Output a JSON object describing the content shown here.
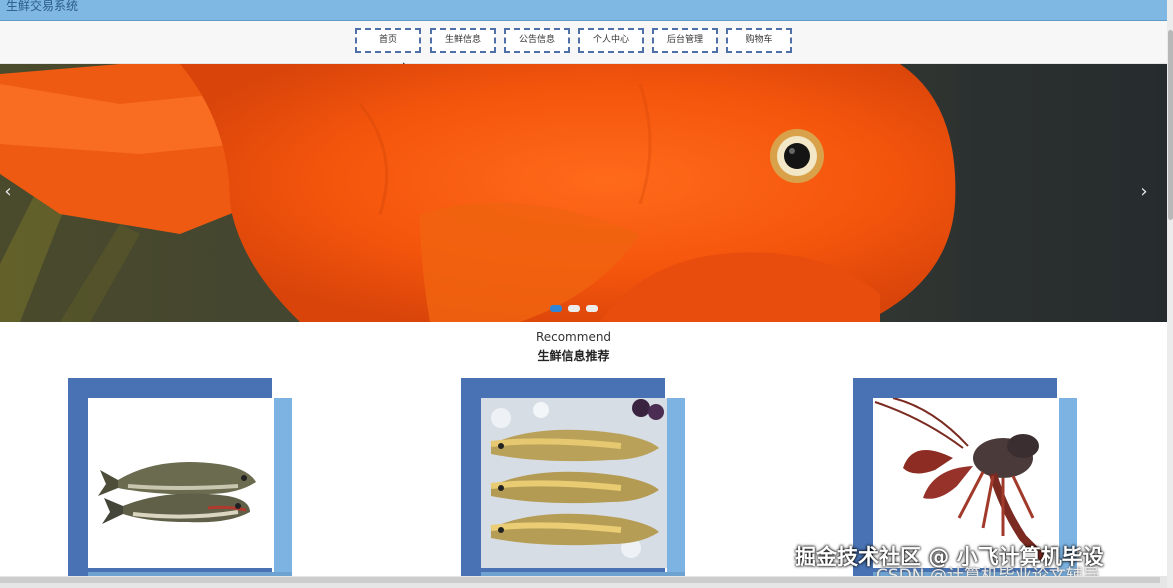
{
  "app": {
    "title": "生鲜交易系统"
  },
  "nav": {
    "items": [
      {
        "label": "首页"
      },
      {
        "label": "生鲜信息"
      },
      {
        "label": "公告信息"
      },
      {
        "label": "个人中心"
      },
      {
        "label": "后台管理"
      },
      {
        "label": "购物车"
      }
    ]
  },
  "banner": {
    "prev_icon": "chevron-left",
    "next_icon": "chevron-right",
    "slides": 3,
    "active_slide": 1,
    "prev_glyph": "‹",
    "next_glyph": "›"
  },
  "section": {
    "title_en": "Recommend",
    "title_zh": "生鲜信息推荐"
  },
  "products": [
    {
      "image": "two-carp-fish"
    },
    {
      "image": "three-yellow-croaker-fish"
    },
    {
      "image": "red-crayfish"
    }
  ],
  "watermark": {
    "line1": "掘金技术社区 @ 小飞计算机毕设",
    "line2": "CSDN @计算机毕业论文辅导"
  },
  "colors": {
    "topbar": "#7fb9e3",
    "nav_border": "#4f6fa8",
    "card_back": "#4872b3",
    "card_side": "#7cb3e2",
    "dot_active": "#2f86d6"
  }
}
